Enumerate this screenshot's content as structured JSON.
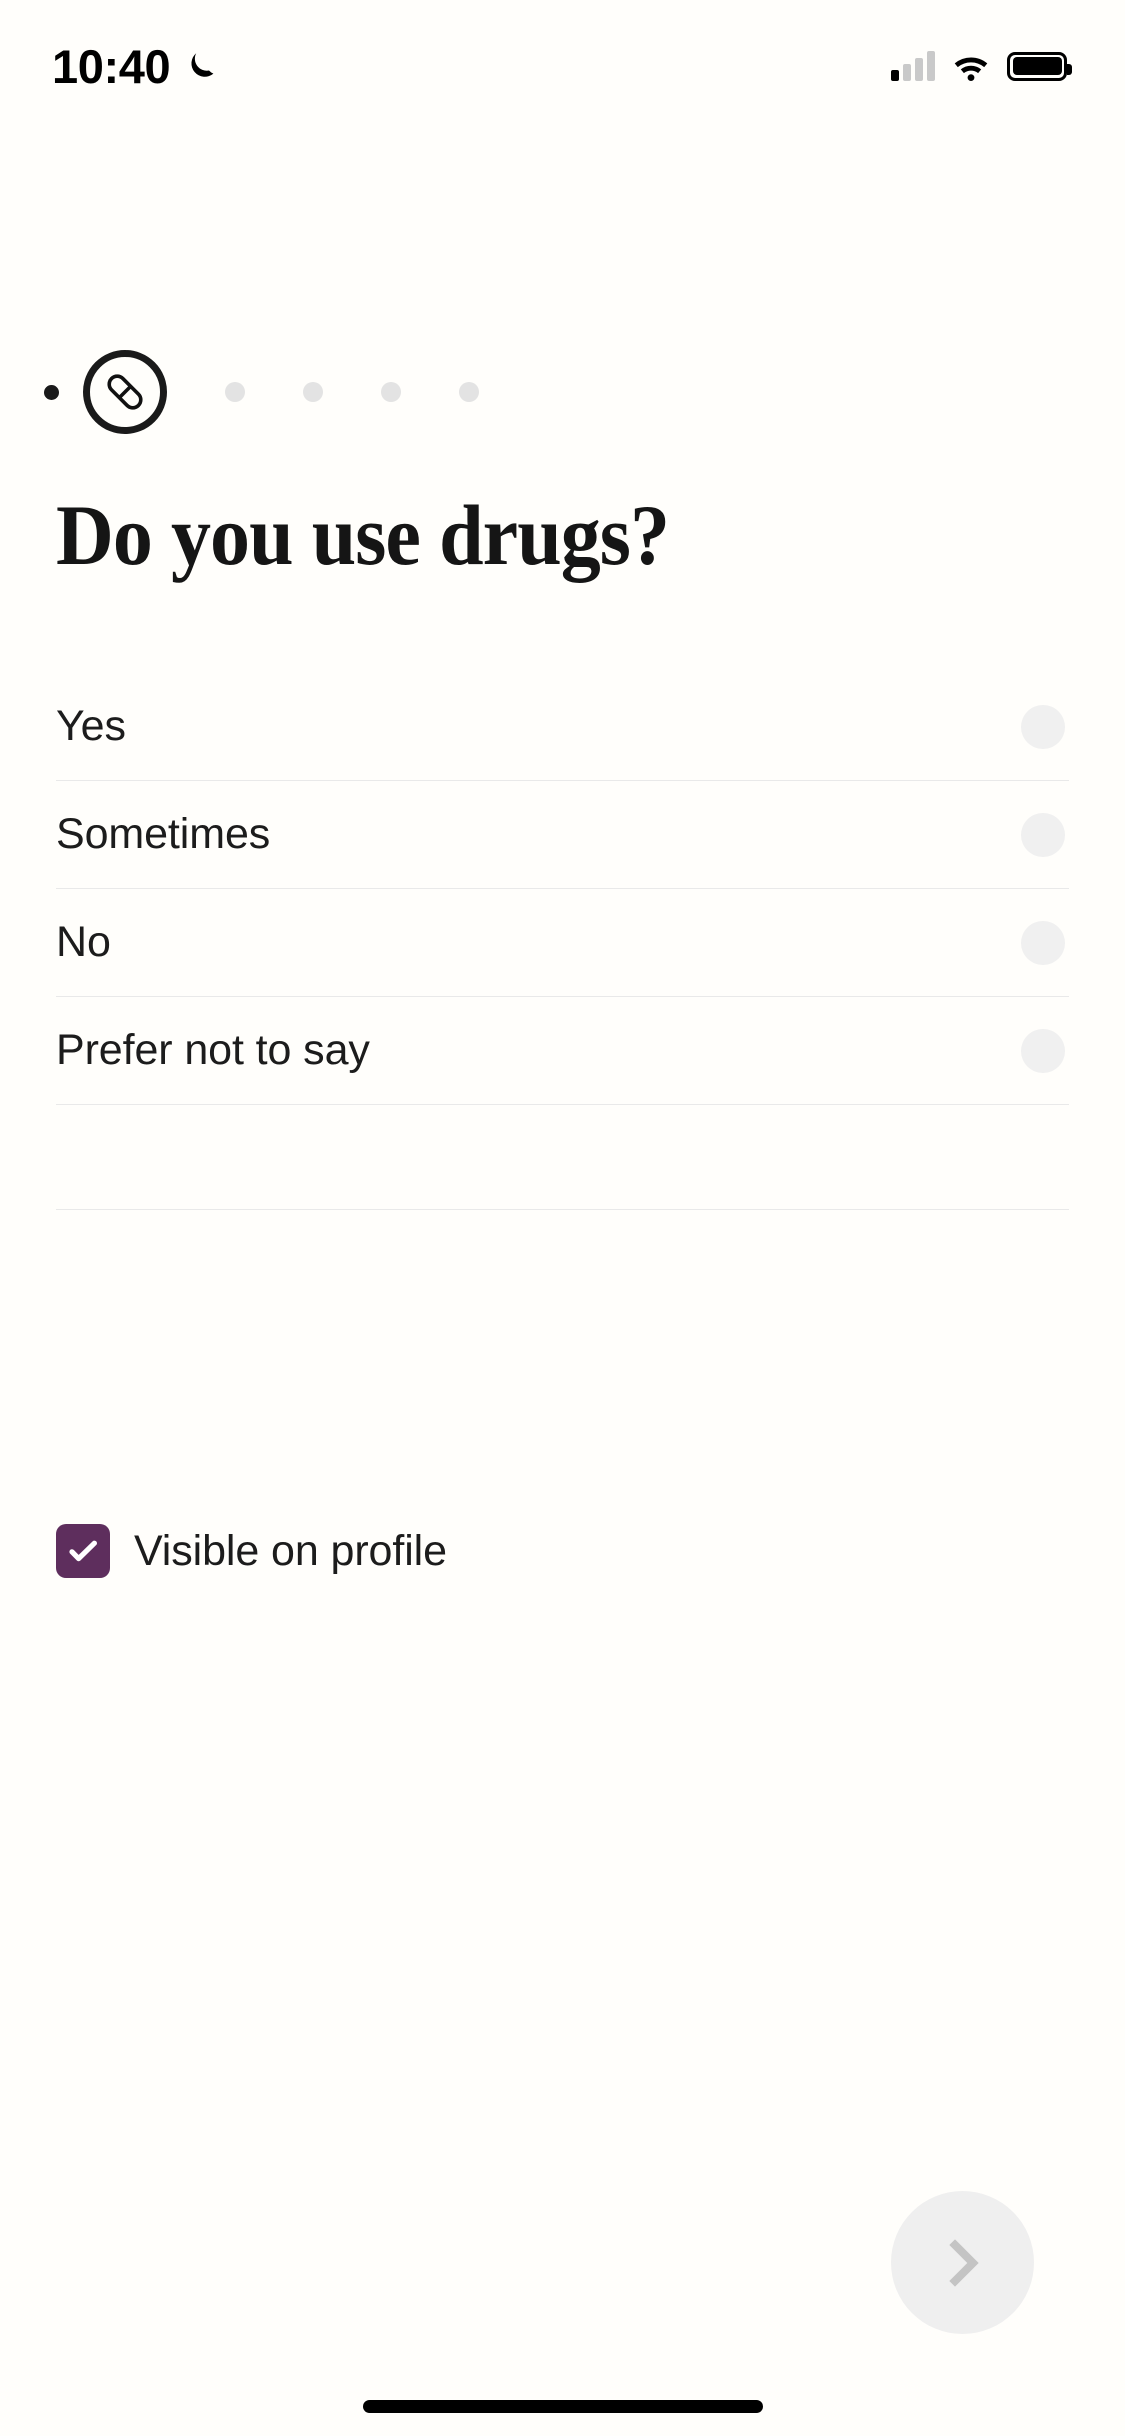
{
  "status_bar": {
    "time": "10:40",
    "dnd_icon": "crescent-moon-icon",
    "signal_icon": "cellular-signal-icon",
    "signal_bars_filled": 1,
    "signal_bars_total": 4,
    "wifi_icon": "wifi-icon",
    "battery_icon": "battery-full-icon"
  },
  "progress": {
    "active_step_icon": "pill-capsule-icon",
    "leading_dot": "completed-step-dot",
    "upcoming_steps": 4,
    "active_index": 1,
    "total_steps": 6
  },
  "question": {
    "title": "Do you use drugs?"
  },
  "options": [
    {
      "label": "Yes",
      "selected": false,
      "control": "radio-unselected"
    },
    {
      "label": "Sometimes",
      "selected": false,
      "control": "radio-unselected"
    },
    {
      "label": "No",
      "selected": false,
      "control": "radio-unselected"
    },
    {
      "label": "Prefer not to say",
      "selected": false,
      "control": "radio-unselected"
    }
  ],
  "visibility": {
    "label": "Visible on profile",
    "checked": true,
    "icon": "checkmark-icon"
  },
  "next_button": {
    "icon": "chevron-right-icon",
    "enabled": false
  },
  "colors": {
    "accent_purple": "#5e2e5d",
    "radio_unselected": "#f0f0f0",
    "divider": "#e9e9e9",
    "fab_background": "#efefef",
    "fab_chevron": "#c4c4c4",
    "text_primary": "#1c1c1c",
    "title_color": "#151515",
    "dot_inactive": "#e3e3e3",
    "dot_active": "#1a1a1a",
    "background": "#fffefb"
  }
}
